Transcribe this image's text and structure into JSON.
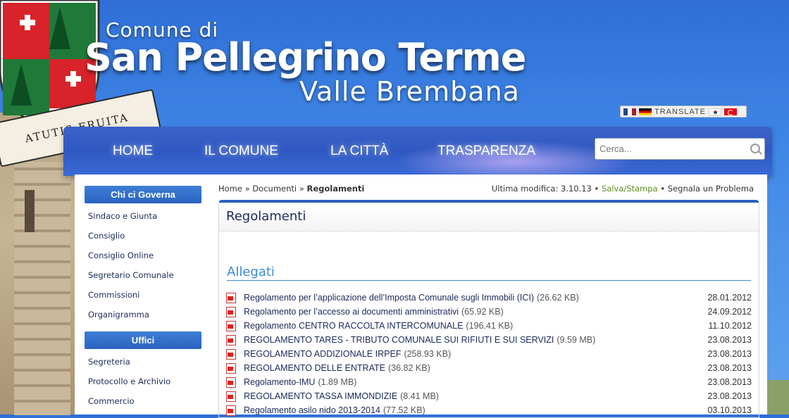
{
  "header": {
    "title_small": "Comune di",
    "title_big": "San Pellegrino Terme",
    "title_sub": "Valle Brembana",
    "crest_motto": "ATUTIS·FRUITA"
  },
  "translate": {
    "label": "TRANSLATE",
    "flags": [
      "fr-flag-icon",
      "de-flag-icon",
      "kr-flag-icon",
      "tr-flag-icon"
    ]
  },
  "nav": {
    "items": [
      "HOME",
      "IL COMUNE",
      "LA CITTÀ",
      "TRASPARENZA"
    ]
  },
  "search": {
    "placeholder": "Cerca..."
  },
  "sidebar": {
    "sections": [
      {
        "heading": "Chi ci Governa",
        "items": [
          "Sindaco e Giunta",
          "Consiglio",
          "Consiglio Online",
          "Segretario Comunale",
          "Commissioni",
          "Organigramma"
        ]
      },
      {
        "heading": "Uffici",
        "items": [
          "Segreteria",
          "Protocollo e Archivio",
          "Commercio"
        ]
      }
    ]
  },
  "breadcrumb": {
    "home": "Home",
    "sep": "»",
    "documenti": "Documenti",
    "current": "Regolamenti"
  },
  "meta": {
    "last_modified_label": "Ultima modifica: 3.10.13",
    "bullet": "•",
    "save_print": "Salva/Stampa",
    "report": "Segnala un Problema"
  },
  "content": {
    "title": "Regolamenti",
    "attachments_heading": "Allegati",
    "files": [
      {
        "name": "Regolamento per l’applicazione dell’Imposta Comunale sugli Immobili (ICI)",
        "size": "(26.62 KB)",
        "date": "28.01.2012"
      },
      {
        "name": "Regolamento per l’accesso ai documenti amministrativi",
        "size": "(65.92 KB)",
        "date": "24.09.2012"
      },
      {
        "name": "Regolamento CENTRO RACCOLTA INTERCOMUNALE",
        "size": "(196.41 KB)",
        "date": "11.10.2012"
      },
      {
        "name": "REGOLAMENTO TARES - TRIBUTO COMUNALE SUI RIFIUTI E SUI SERVIZI",
        "size": "(9.59 MB)",
        "date": "23.08.2013"
      },
      {
        "name": "REGOLAMENTO ADDIZIONALE IRPEF",
        "size": "(258.93 KB)",
        "date": "23.08.2013"
      },
      {
        "name": "REGOLAMENTO DELLE ENTRATE",
        "size": "(36.82 KB)",
        "date": "23.08.2013"
      },
      {
        "name": "Regolamento-IMU",
        "size": "(1.89 MB)",
        "date": "23.08.2013"
      },
      {
        "name": "REGOLAMENTO TASSA IMMONDIZIE",
        "size": "(8.41 MB)",
        "date": "23.08.2013"
      },
      {
        "name": "Regolamento asilo nido 2013-2014",
        "size": "(77.52 KB)",
        "date": "03.10.2013"
      }
    ]
  },
  "colors": {
    "accent": "#2a5fbd",
    "link": "#1a2a5a",
    "green": "#5b8a1e",
    "attachments": "#3a8ad8"
  }
}
